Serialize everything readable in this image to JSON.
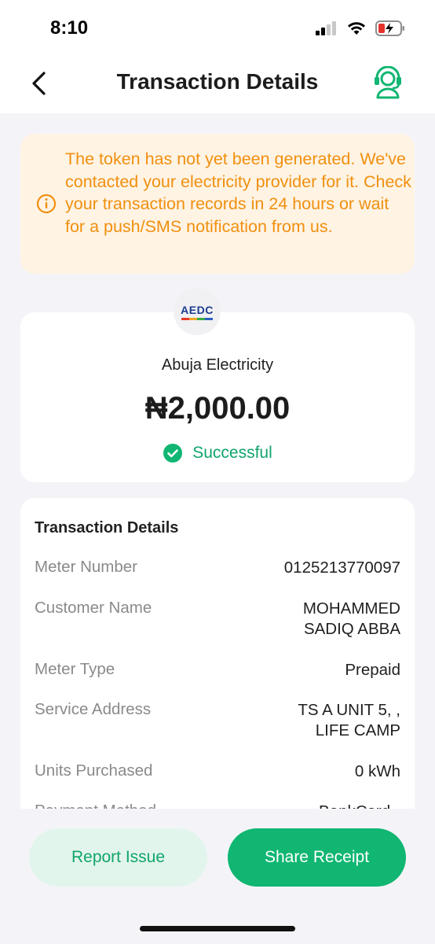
{
  "status_bar": {
    "time": "8:10"
  },
  "header": {
    "title": "Transaction Details"
  },
  "warning": {
    "message": "The token has not yet been generated. We've contacted your electricity provider for it. Check your transaction records in 24 hours or wait for a push/SMS notification from us."
  },
  "merchant": {
    "logo_text": "AEDC",
    "name": "Abuja Electricity",
    "amount": "₦2,000.00",
    "status": "Successful"
  },
  "details": {
    "title": "Transaction Details",
    "rows": [
      {
        "label": "Meter Number",
        "value": "0125213770097"
      },
      {
        "label": "Customer Name",
        "value_line1": "MOHAMMED",
        "value_line2": "SADIQ ABBA"
      },
      {
        "label": "Meter Type",
        "value": "Prepaid"
      },
      {
        "label": "Service Address",
        "value_line1": "TS A UNIT 5, ,",
        "value_line2": "LIFE CAMP"
      },
      {
        "label": "Units Purchased",
        "value": "0 kWh"
      },
      {
        "label": "Payment Method",
        "value": "BankCard"
      }
    ]
  },
  "actions": {
    "report_label": "Report Issue",
    "share_label": "Share Receipt"
  },
  "colors": {
    "accent": "#10b672",
    "success_text": "#10a56b",
    "warning_text": "#f0900f",
    "warning_bg": "#fff3e4"
  }
}
